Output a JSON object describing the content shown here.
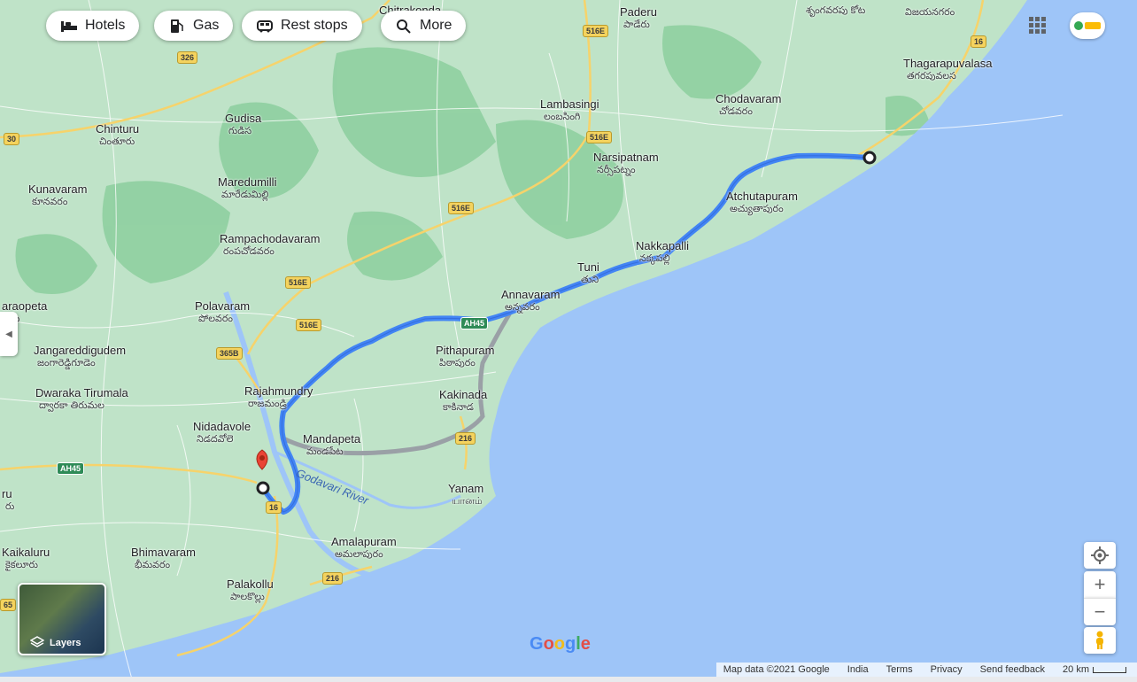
{
  "chips": [
    {
      "label": "Hotels",
      "icon": "bed-icon"
    },
    {
      "label": "Gas",
      "icon": "gas-pump-icon"
    },
    {
      "label": "Rest stops",
      "icon": "rest-stop-icon"
    },
    {
      "label": "More",
      "icon": "search-icon"
    }
  ],
  "places": [
    {
      "id": "paderu",
      "en": "Paderu",
      "te": "పాడేరు"
    },
    {
      "id": "chitrakonda",
      "en": "Chitrakonda",
      "te": ""
    },
    {
      "id": "vizianagaram",
      "en": "",
      "te": "విజయనగరం"
    },
    {
      "id": "srungavarapukota",
      "en": "",
      "te": "శృంగవరపు కోట"
    },
    {
      "id": "thagarapuvalasa",
      "en": "Thagarapuvalasa",
      "te": "తగరపువలస"
    },
    {
      "id": "lambasingi",
      "en": "Lambasingi",
      "te": "లంబసింగి"
    },
    {
      "id": "chodavaram",
      "en": "Chodavaram",
      "te": "చోడవరం"
    },
    {
      "id": "chinturu",
      "en": "Chinturu",
      "te": "చింతూరు"
    },
    {
      "id": "gudisa",
      "en": "Gudisa",
      "te": "గుడిస"
    },
    {
      "id": "narsipatnam",
      "en": "Narsipatnam",
      "te": "నర్సీపట్నం"
    },
    {
      "id": "maredumilli",
      "en": "Maredumilli",
      "te": "మారేడుమిల్లి"
    },
    {
      "id": "kunavaram",
      "en": "Kunavaram",
      "te": "కూనవరం"
    },
    {
      "id": "atchutapuram",
      "en": "Atchutapuram",
      "te": "అచ్యుతాపురం"
    },
    {
      "id": "rampachodavaram",
      "en": "Rampachodavaram",
      "te": "రంపచోడవరం"
    },
    {
      "id": "nakkapalli",
      "en": "Nakkapalli",
      "te": "నక్కపల్లి"
    },
    {
      "id": "tuni",
      "en": "Tuni",
      "te": "తుని"
    },
    {
      "id": "annavaram",
      "en": "Annavaram",
      "te": "అన్నవరం"
    },
    {
      "id": "polavaram",
      "en": "Polavaram",
      "te": "పోలవరం"
    },
    {
      "id": "aswaraopeta",
      "en": "araopeta",
      "te": "పేట"
    },
    {
      "id": "jangareddigudem",
      "en": "Jangareddigudem",
      "te": "జంగారెడ్డిగూడెం"
    },
    {
      "id": "pithapuram",
      "en": "Pithapuram",
      "te": "పిఠాపురం"
    },
    {
      "id": "dwaraka",
      "en": "Dwaraka Tirumala",
      "te": "ద్వారకా తిరుమల"
    },
    {
      "id": "rajahmundry",
      "en": "Rajahmundry",
      "te": "రాజమండ్రి"
    },
    {
      "id": "kakinada",
      "en": "Kakinada",
      "te": "కాకినాడ"
    },
    {
      "id": "nidadavole",
      "en": "Nidadavole",
      "te": "నిడదవోలె"
    },
    {
      "id": "mandapeta",
      "en": "Mandapeta",
      "te": "మండపేట"
    },
    {
      "id": "yanam",
      "en": "Yanam",
      "te": "யானம்"
    },
    {
      "id": "eluru",
      "en": "ru",
      "te": "రు"
    },
    {
      "id": "amalapuram",
      "en": "Amalapuram",
      "te": "అమలాపురం"
    },
    {
      "id": "kaikaluru",
      "en": "Kaikaluru",
      "te": "కైకలూరు"
    },
    {
      "id": "bhimavaram",
      "en": "Bhimavaram",
      "te": "భీమవరం"
    },
    {
      "id": "palakollu",
      "en": "Palakollu",
      "te": "పాలకొల్లు"
    }
  ],
  "roads": [
    "516E",
    "326",
    "16",
    "30",
    "516E",
    "516E",
    "516E",
    "516E",
    "365B",
    "AH45",
    "AH45",
    "16",
    "216",
    "216",
    "65"
  ],
  "water_label": "Godavari River",
  "side_panel_toggle": "◀",
  "controls": {
    "zoom_in": "+",
    "zoom_out": "−"
  },
  "layers_label": "Layers",
  "logo": "Google",
  "footer": [
    "Map data ©2021 Google",
    "India",
    "Terms",
    "Privacy",
    "Send feedback",
    "20 km"
  ],
  "colors": {
    "land": "#bfe3c8",
    "sea": "#9ec5f8",
    "forest": "#8ccf9e",
    "route": "#4285f4",
    "alt_route": "#9aa0a6",
    "road": "#f6d36b"
  }
}
